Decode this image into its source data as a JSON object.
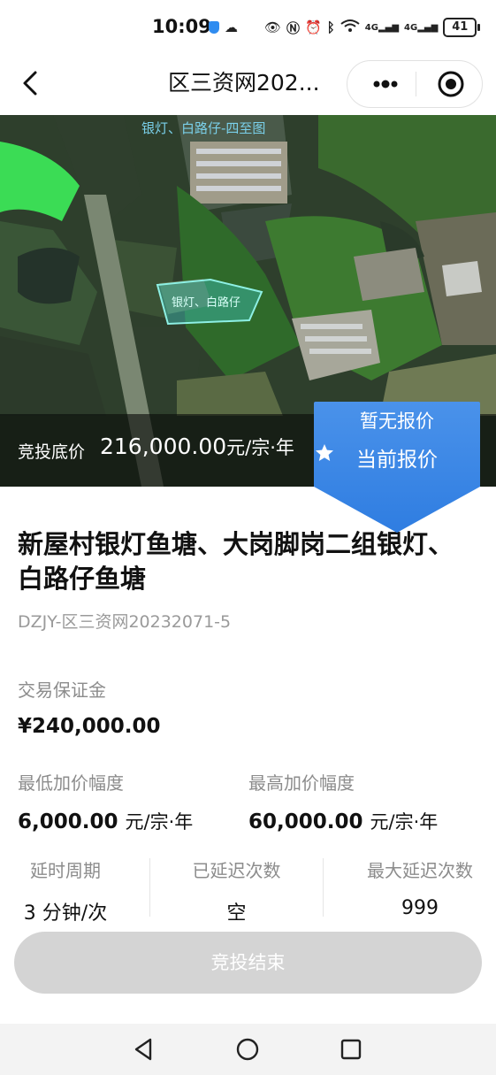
{
  "status_bar": {
    "time": "10:09",
    "signal_a": "4G",
    "signal_b": "4G",
    "battery": "41"
  },
  "nav": {
    "title": "区三资网202..."
  },
  "hero": {
    "map_label_top": "银灯、白路仔-四至图",
    "map_label_pond": "银灯、白路仔",
    "price_label": "竞投底价",
    "price_value": "216,000.00",
    "price_unit": "元/宗·年"
  },
  "badge": {
    "line1": "暂无报价",
    "line2": "当前报价",
    "color": "#2f7de1"
  },
  "item": {
    "title": "新屋村银灯鱼塘、大岗脚岗二组银灯、白路仔鱼塘",
    "code": "DZJY-区三资网20232071-5"
  },
  "deposit": {
    "label": "交易保证金",
    "value": "¥240,000.00"
  },
  "increment": {
    "min_label": "最低加价幅度",
    "min_value": "6,000.00",
    "min_unit": "元/宗·年",
    "max_label": "最高加价幅度",
    "max_value": "60,000.00",
    "max_unit": "元/宗·年"
  },
  "delay": {
    "period_label": "延时周期",
    "period_value": "3 分钟/次",
    "count_label": "已延迟次数",
    "count_value": "空",
    "max_label": "最大延迟次数",
    "max_value": "999"
  },
  "action": {
    "button_label": "竞投结束"
  }
}
